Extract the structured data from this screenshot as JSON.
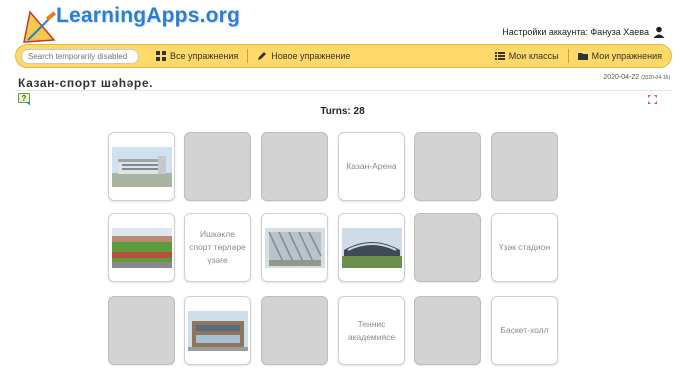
{
  "header": {
    "logo_text": "LearningApps.org",
    "account_label": "Настройки аккаунта: Фануза Хаева",
    "account_icon": "user-icon"
  },
  "nav": {
    "search_placeholder": "Search temporarily disabled",
    "items_left": [
      {
        "label": "Все упражнения",
        "icon": "grid-icon"
      },
      {
        "label": "Новое упражнение",
        "icon": "pencil-icon"
      }
    ],
    "items_right": [
      {
        "label": "Мои классы",
        "icon": "list-icon"
      },
      {
        "label": "Мои упражнения",
        "icon": "folder-icon"
      }
    ],
    "accent_color": "#ffd96a"
  },
  "page": {
    "title": "Казан-спорт шәһәре.",
    "date": "2020-04-22",
    "date_small": "(2020-04-16)",
    "turns_label": "Turns: 28"
  },
  "cards": [
    {
      "state": "open",
      "kind": "image",
      "icon": "building-photo"
    },
    {
      "state": "hidden"
    },
    {
      "state": "hidden"
    },
    {
      "state": "open",
      "kind": "text",
      "text": "Казан-Арена"
    },
    {
      "state": "hidden"
    },
    {
      "state": "hidden"
    },
    {
      "state": "open",
      "kind": "image",
      "icon": "stadium-field-photo"
    },
    {
      "state": "open",
      "kind": "text",
      "text": "Ишкәкле спорт төрләре үзәге"
    },
    {
      "state": "open",
      "kind": "image",
      "icon": "glass-facade-photo"
    },
    {
      "state": "open",
      "kind": "image",
      "icon": "arena-photo"
    },
    {
      "state": "hidden"
    },
    {
      "state": "open",
      "kind": "text",
      "text": "Үзәк стадион"
    },
    {
      "state": "hidden"
    },
    {
      "state": "open",
      "kind": "image",
      "icon": "academy-building-photo"
    },
    {
      "state": "hidden"
    },
    {
      "state": "open",
      "kind": "text",
      "text": "Теннис академиясе"
    },
    {
      "state": "hidden"
    },
    {
      "state": "open",
      "kind": "text",
      "text": "Баскет-холл"
    }
  ]
}
